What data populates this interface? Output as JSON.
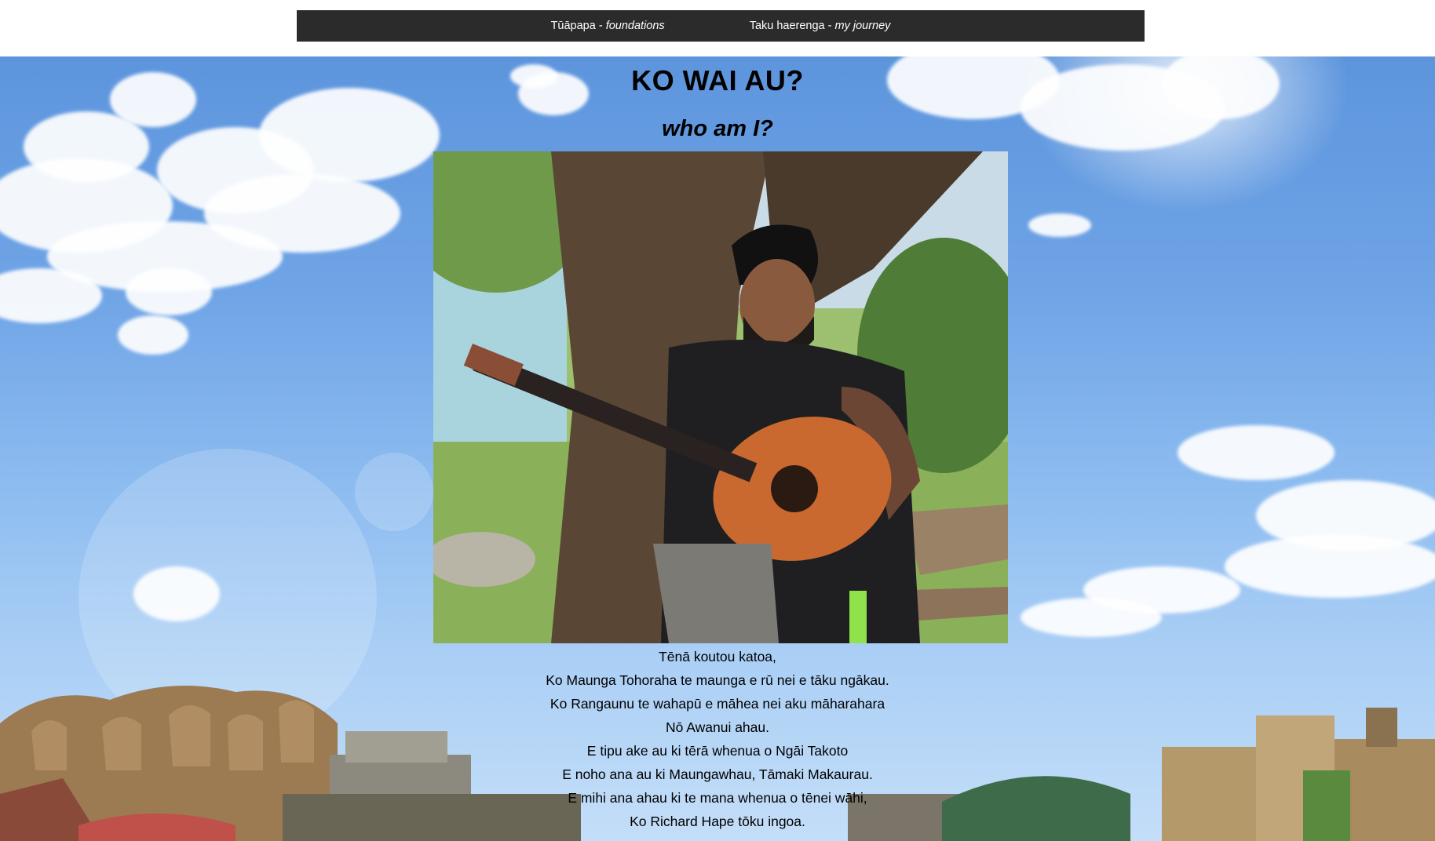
{
  "nav": {
    "items": [
      {
        "main": "Tūāpapa - ",
        "sub": "foundations"
      },
      {
        "main": "Taku haerenga - ",
        "sub": "my journey"
      }
    ]
  },
  "header": {
    "title": "KO WAI AU?",
    "subtitle": "who am I?"
  },
  "photo": {
    "icon": "portrait-photo-man-with-guitar"
  },
  "poem": {
    "lines": [
      "Tēnā koutou katoa,",
      "Ko Maunga Tohoraha te maunga e rū nei e tāku ngākau.",
      "Ko Rangaunu te wahapū e māhea nei aku māharahara",
      "Nō Awanui ahau.",
      "E tipu ake au ki tērā whenua o Ngāi Takoto",
      "E noho ana au ki Maungawhau, Tāmaki Makaurau.",
      "E mihi ana ahau ki te mana whenua o tēnei wāhi,",
      "Ko Richard Hape tōku ingoa."
    ]
  },
  "colors": {
    "navbar": "#2b2b2b",
    "sky": "#6fa4e6",
    "text": "#000000"
  }
}
